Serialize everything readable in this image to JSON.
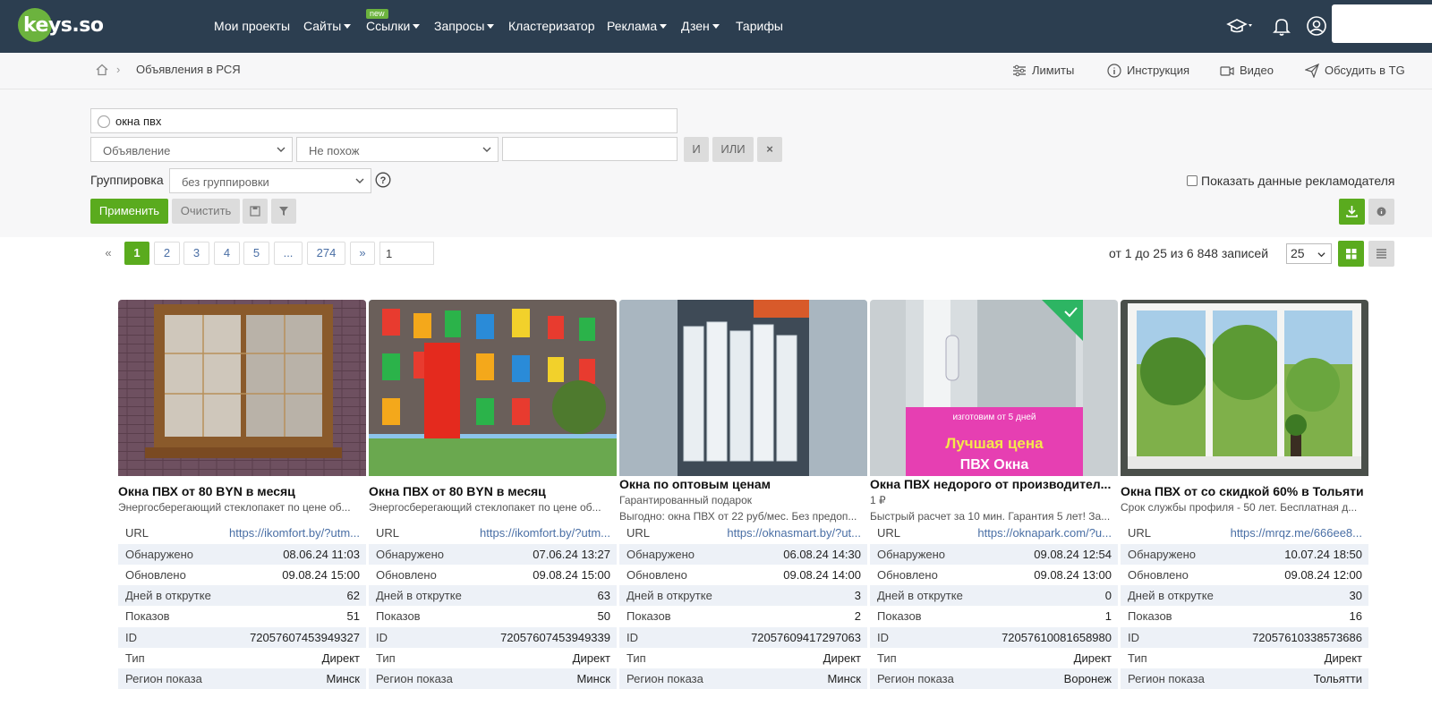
{
  "brand": {
    "logo_text": "keys.so",
    "accent": "#6cb33e",
    "nav_bg": "#2c3e50"
  },
  "nav": {
    "items": [
      {
        "label": "Мои проекты"
      },
      {
        "label": "Сайты"
      },
      {
        "label": "Ссылки"
      },
      {
        "label": "Запросы"
      },
      {
        "label": "Кластеризатор"
      },
      {
        "label": "Реклама"
      },
      {
        "label": "Дзен"
      },
      {
        "label": "Тарифы"
      }
    ],
    "new_badge": "new",
    "icons": [
      "graduation-cap-icon",
      "bell-icon",
      "user-icon"
    ]
  },
  "breadcrumb": {
    "page": "Объявления в РСЯ",
    "tools": [
      {
        "label": "Лимиты",
        "icon": "sliders-icon"
      },
      {
        "label": "Инструкция",
        "icon": "info-circle-icon"
      },
      {
        "label": "Видео",
        "icon": "video-icon"
      },
      {
        "label": "Обсудить в TG",
        "icon": "send-icon"
      }
    ]
  },
  "filters": {
    "search_value": "окна пвх",
    "field_select": "Объявление",
    "condition_select": "Не похож",
    "and_label": "И",
    "or_label": "ИЛИ",
    "remove_label": "×",
    "grouping_label": "Группировка",
    "grouping_value": "без группировки",
    "show_advertiser": "Показать данные рекламодателя",
    "apply_label": "Применить",
    "clear_label": "Очистить"
  },
  "pagination": {
    "prev": "«",
    "pages": [
      "1",
      "2",
      "3",
      "4",
      "5",
      "...",
      "274"
    ],
    "next": "»",
    "input_value": "1",
    "records": "от 1 до 25 из 6 848 записей",
    "per_page": "25"
  },
  "cards": [
    {
      "title": "Окна ПВХ от 80 BYN в месяц",
      "sub1": "Энергосберегающий стеклопакет по цене об...",
      "url": "https://ikomfort.by/?utm...",
      "found": "08.06.24 11:03",
      "updated": "09.08.24 15:00",
      "days": "62",
      "shows": "51",
      "id": "72057607453949327",
      "type": "Директ",
      "region": "Минск"
    },
    {
      "title": "Окна ПВХ от 80 BYN в месяц",
      "sub1": "Энергосберегающий стеклопакет по цене об...",
      "url": "https://ikomfort.by/?utm...",
      "found": "07.06.24 13:27",
      "updated": "09.08.24 15:00",
      "days": "63",
      "shows": "50",
      "id": "72057607453949339",
      "type": "Директ",
      "region": "Минск"
    },
    {
      "title": "Окна по оптовым ценам",
      "sub1": "Гарантированный подарок",
      "sub2": "Выгодно: окна ПВХ от 22 руб/мес. Без предоп...",
      "url": "https://oknasmart.by/?ut...",
      "found": "06.08.24 14:30",
      "updated": "09.08.24 14:00",
      "days": "3",
      "shows": "2",
      "id": "72057609417297063",
      "type": "Директ",
      "region": "Минск"
    },
    {
      "title": "Окна ПВХ недорого от производител...",
      "sub1": "1 ₽",
      "sub2": "Быстрый расчет за 10 мин. Гарантия 5 лет! За...",
      "url": "https://oknapark.com/?u...",
      "found": "09.08.24 12:54",
      "updated": "09.08.24 13:00",
      "days": "0",
      "shows": "1",
      "id": "72057610081658980",
      "type": "Директ",
      "region": "Воронеж",
      "banner_top": "изготовим от 5 дней",
      "banner_mid": "Лучшая цена",
      "banner_bot": "ПВХ Окна"
    },
    {
      "title": "Окна ПВХ от со скидкой 60% в Тольяти",
      "sub1": "Срок службы профиля - 50 лет. Бесплатная д...",
      "url": "https://mrqz.me/666ee8...",
      "found": "10.07.24 18:50",
      "updated": "09.08.24 12:00",
      "days": "30",
      "shows": "16",
      "id": "72057610338573686",
      "type": "Директ",
      "region": "Тольятти"
    }
  ],
  "row_labels": {
    "url": "URL",
    "found": "Обнаружено",
    "updated": "Обновлено",
    "days": "Дней в открутке",
    "shows": "Показов",
    "id": "ID",
    "type": "Тип",
    "region": "Регион показа"
  }
}
